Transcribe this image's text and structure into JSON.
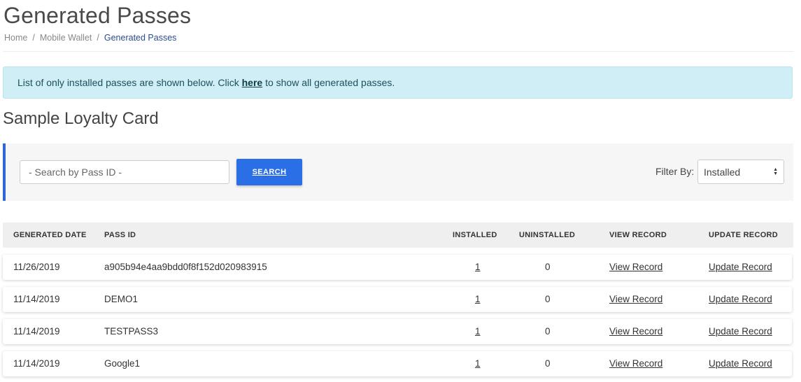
{
  "page": {
    "title": "Generated Passes",
    "breadcrumb": [
      "Home",
      "Mobile Wallet",
      "Generated Passes"
    ]
  },
  "alert": {
    "text_before": "List of only installed passes are shown below. Click ",
    "link": "here",
    "text_after": " to show all generated passes."
  },
  "section_title": "Sample Loyalty Card",
  "search": {
    "placeholder": "- Search by Pass ID -",
    "value": "",
    "button_label": "SEARCH"
  },
  "filter": {
    "label": "Filter By:",
    "selected": "Installed"
  },
  "table": {
    "headers": [
      "GENERATED DATE",
      "PASS ID",
      "INSTALLED",
      "UNINSTALLED",
      "VIEW RECORD",
      "UPDATE RECORD"
    ],
    "rows": [
      {
        "date": "11/26/2019",
        "pass_id": "a905b94e4aa9bdd0f8f152d020983915",
        "installed": "1",
        "uninstalled": "0",
        "view": "View Record",
        "update": "Update Record"
      },
      {
        "date": "11/14/2019",
        "pass_id": "DEMO1",
        "installed": "1",
        "uninstalled": "0",
        "view": "View Record",
        "update": "Update Record"
      },
      {
        "date": "11/14/2019",
        "pass_id": "TESTPASS3",
        "installed": "1",
        "uninstalled": "0",
        "view": "View Record",
        "update": "Update Record"
      },
      {
        "date": "11/14/2019",
        "pass_id": "Google1",
        "installed": "1",
        "uninstalled": "0",
        "view": "View Record",
        "update": "Update Record"
      }
    ]
  },
  "colors": {
    "accent": "#2b6fe6",
    "alert_bg": "#cfeef5",
    "breadcrumb_active": "#2a4b8d"
  }
}
